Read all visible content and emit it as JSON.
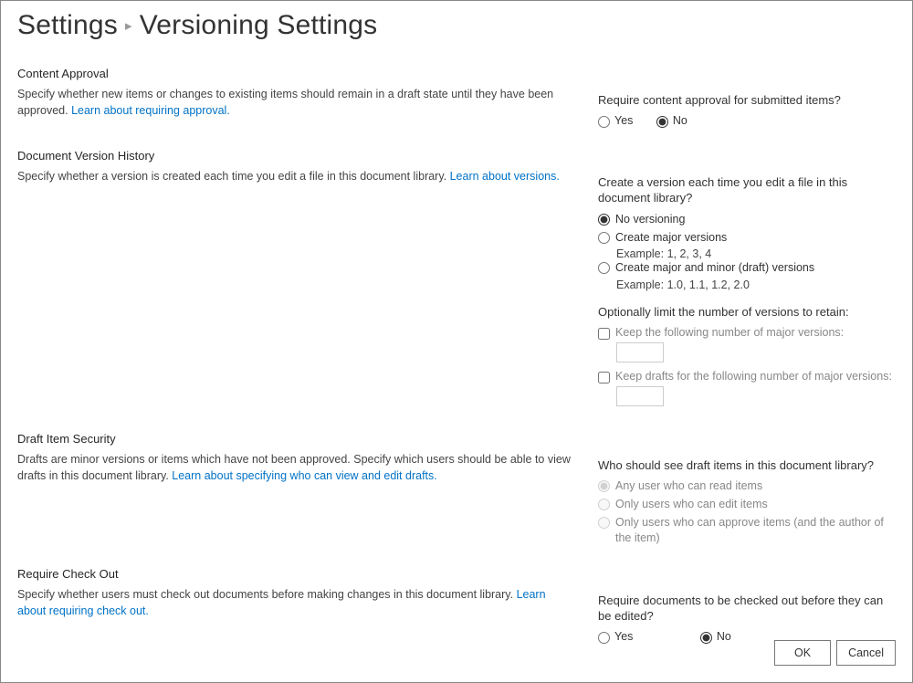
{
  "breadcrumb": {
    "parent": "Settings",
    "current": "Versioning Settings"
  },
  "sections": {
    "content_approval": {
      "title": "Content Approval",
      "desc": "Specify whether new items or changes to existing items should remain in a draft state until they have been approved.  ",
      "link": "Learn about requiring approval.",
      "question": "Require content approval for submitted items?",
      "yes": "Yes",
      "no": "No"
    },
    "version_history": {
      "title": "Document Version History",
      "desc": "Specify whether a version is created each time you edit a file in this document library.  ",
      "link": "Learn about versions.",
      "question": "Create a version each time you edit a file in this document library?",
      "opt1": "No versioning",
      "opt2": "Create major versions",
      "opt2_ex": "Example: 1, 2, 3, 4",
      "opt3": "Create major and minor (draft) versions",
      "opt3_ex": "Example: 1.0, 1.1, 1.2, 2.0",
      "limit_label": "Optionally limit the number of versions to retain:",
      "chk1": "Keep the following number of major versions:",
      "chk2": "Keep drafts for the following number of major versions:"
    },
    "draft_security": {
      "title": "Draft Item Security",
      "desc": "Drafts are minor versions or items which have not been approved. Specify which users should be able to view drafts in this document library.  ",
      "link": "Learn about specifying who can view and edit drafts.",
      "question": "Who should see draft items in this document library?",
      "opt1": "Any user who can read items",
      "opt2": "Only users who can edit items",
      "opt3": "Only users who can approve items (and the author of the item)"
    },
    "require_checkout": {
      "title": "Require Check Out",
      "desc": "Specify whether users must check out documents before making changes in this document library.  ",
      "link": "Learn about requiring check out.",
      "question": "Require documents to be checked out before they can be edited?",
      "yes": "Yes",
      "no": "No"
    }
  },
  "buttons": {
    "ok": "OK",
    "cancel": "Cancel"
  }
}
